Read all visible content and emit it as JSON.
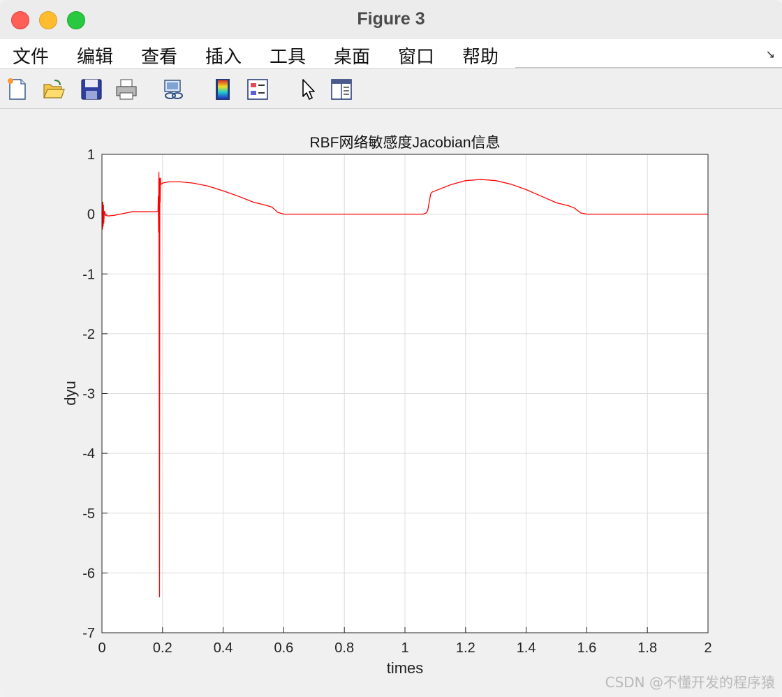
{
  "window": {
    "title": "Figure 3"
  },
  "menu": {
    "items": [
      "文件",
      "编辑",
      "查看",
      "插入",
      "工具",
      "桌面",
      "窗口",
      "帮助"
    ],
    "corner_glyph": "↘"
  },
  "toolbar": {
    "tools": [
      {
        "name": "new-figure-icon"
      },
      {
        "name": "open-file-icon"
      },
      {
        "name": "save-icon"
      },
      {
        "name": "print-icon"
      },
      {
        "name": "link-icon"
      },
      {
        "name": "colorbar-icon"
      },
      {
        "name": "legend-icon"
      },
      {
        "name": "pointer-icon"
      },
      {
        "name": "property-editor-icon"
      }
    ]
  },
  "chart_data": {
    "type": "line",
    "title": "RBF网络敏感度Jacobian信息",
    "xlabel": "times",
    "ylabel": "dyu",
    "xlim": [
      0,
      2
    ],
    "ylim": [
      -7,
      1
    ],
    "xticks": [
      "0",
      "0.2",
      "0.4",
      "0.6",
      "0.8",
      "1",
      "1.2",
      "1.4",
      "1.6",
      "1.8",
      "2"
    ],
    "yticks": [
      "1",
      "0",
      "-1",
      "-2",
      "-3",
      "-4",
      "-5",
      "-6",
      "-7"
    ],
    "grid": true,
    "color": "#ff0000",
    "series": [
      {
        "x": [
          0,
          0.001,
          0.002,
          0.003,
          0.004,
          0.005,
          0.006,
          0.008,
          0.012,
          0.02,
          0.04,
          0.06,
          0.08,
          0.1,
          0.12,
          0.15,
          0.18,
          0.185,
          0.186,
          0.187,
          0.188,
          0.189,
          0.19,
          0.191,
          0.192,
          0.193,
          0.194,
          0.196,
          0.2,
          0.22,
          0.26,
          0.3,
          0.35,
          0.4,
          0.45,
          0.5,
          0.54,
          0.56,
          0.57,
          0.58,
          0.6,
          0.8,
          1.0,
          1.06,
          1.07,
          1.075,
          1.08,
          1.085,
          1.09,
          1.12,
          1.15,
          1.2,
          1.25,
          1.3,
          1.35,
          1.4,
          1.45,
          1.5,
          1.54,
          1.56,
          1.57,
          1.58,
          1.6,
          1.8,
          2.0
        ],
        "y": [
          0,
          0.2,
          -0.25,
          0.2,
          -0.2,
          0.15,
          -0.15,
          0.05,
          -0.02,
          -0.03,
          -0.02,
          0.0,
          0.02,
          0.04,
          0.04,
          0.04,
          0.04,
          0.05,
          0.3,
          -0.3,
          0.7,
          -2.0,
          -6.4,
          0.6,
          0.2,
          0.6,
          0.5,
          0.5,
          0.52,
          0.54,
          0.54,
          0.52,
          0.47,
          0.39,
          0.3,
          0.2,
          0.15,
          0.12,
          0.08,
          0.03,
          0.0,
          0.0,
          0.0,
          0.0,
          0.02,
          0.06,
          0.2,
          0.34,
          0.37,
          0.43,
          0.49,
          0.56,
          0.58,
          0.56,
          0.5,
          0.41,
          0.3,
          0.19,
          0.14,
          0.1,
          0.06,
          0.02,
          0.0,
          0.0,
          0.0
        ]
      }
    ]
  },
  "watermark": "CSDN @不懂开发的程序猿"
}
